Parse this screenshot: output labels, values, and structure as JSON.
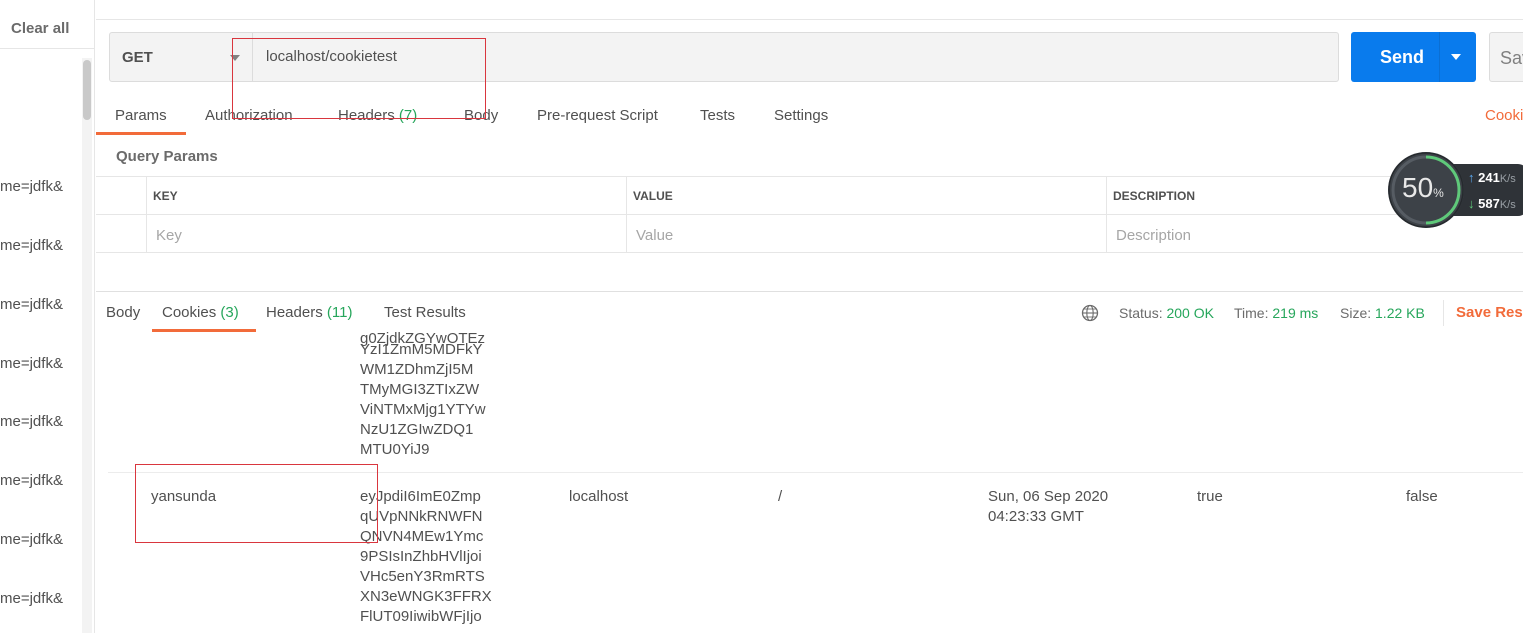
{
  "sidebar": {
    "clear_all": "Clear all",
    "history": [
      "me=jdfk&",
      "me=jdfk&",
      "me=jdfk&",
      "me=jdfk&",
      "me=jdfk&",
      "me=jdfk&",
      "me=jdfk&",
      "me=jdfk&"
    ]
  },
  "request": {
    "method": "GET",
    "url": "localhost/cookietest",
    "send_label": "Send",
    "save_label": "Sav"
  },
  "request_tabs": {
    "params": "Params",
    "authorization": "Authorization",
    "headers": "Headers",
    "headers_count": "(7)",
    "body": "Body",
    "pre_request": "Pre-request Script",
    "tests": "Tests",
    "settings": "Settings",
    "cookies_link": "Cooki"
  },
  "query_params": {
    "title": "Query Params",
    "columns": [
      "KEY",
      "VALUE",
      "DESCRIPTION"
    ],
    "placeholders": [
      "Key",
      "Value",
      "Description"
    ]
  },
  "response": {
    "tabs": {
      "body": "Body",
      "cookies": "Cookies",
      "cookies_count": "(3)",
      "headers": "Headers",
      "headers_count": "(11)",
      "test_results": "Test Results"
    },
    "status_label": "Status:",
    "status_value": "200 OK",
    "time_label": "Time:",
    "time_value": "219 ms",
    "size_label": "Size:",
    "size_value": "1.22 KB",
    "save_response": "Save Resp"
  },
  "cookies": {
    "prev_value_lines": "YzI1ZmM5MDFkY\nWM1ZDhmZjI5M\nTMyMGI3ZTIxZW\nViNTMxMjg1YTYw\nNzU1ZGIwZDQ1\nMTU0YiJ9",
    "row": {
      "name": "yansunda",
      "value_lines": "eyJpdiI6ImE0Zmp\nqUVpNNkRNWFN\nQNVN4MEw1Ymc\n9PSIsInZhbHVlIjoi\nVHc5enY3RmRTS\nXN3eWNGK3FFRX\nFlUT09IiwibWFjIjo",
      "domain": "localhost",
      "path": "/",
      "expires_line1": "Sun, 06 Sep 2020",
      "expires_line2": "04:23:33 GMT",
      "http_only": "true",
      "secure": "false"
    }
  },
  "speed_widget": {
    "percent": "50",
    "percent_sign": "%",
    "upload": "241",
    "download": "587",
    "unit": "K/s"
  }
}
